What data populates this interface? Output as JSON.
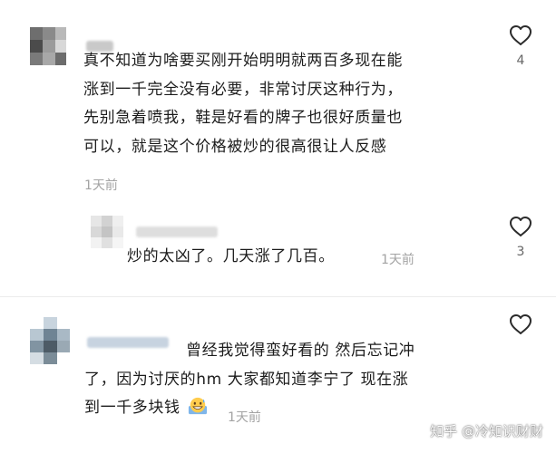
{
  "comments": [
    {
      "text_lines": [
        "真不知道为啥要买刚开始明明就两百多现在能",
        "涨到一千完全没有必要，非常讨厌这种行为，",
        "先别急着喷我，鞋是好看的牌子也很好质量也",
        "可以，就是这个价格被炒的很高很让人反感"
      ],
      "time": "1天前",
      "like_count": "4"
    },
    {
      "text": "炒的太凶了。几天涨了几百。",
      "time": "1天前",
      "like_count": "3"
    },
    {
      "text_lines": [
        "曾经我觉得蛮好看的 然后忘记冲",
        "了，因为讨厌的hm 大家都知道李宁了 现在涨",
        "到一千多块钱"
      ],
      "time": "1天前",
      "like_count": ""
    }
  ],
  "icons": {
    "like": "heart-outline-icon",
    "emoji": "grinning-sweat-emoji-icon"
  },
  "watermark": "知乎 @冷知识财财",
  "colors": {
    "text": "#1c1c1c",
    "meta": "#a3a3a3",
    "icon": "#2b2b2b",
    "divider": "#ececec"
  }
}
